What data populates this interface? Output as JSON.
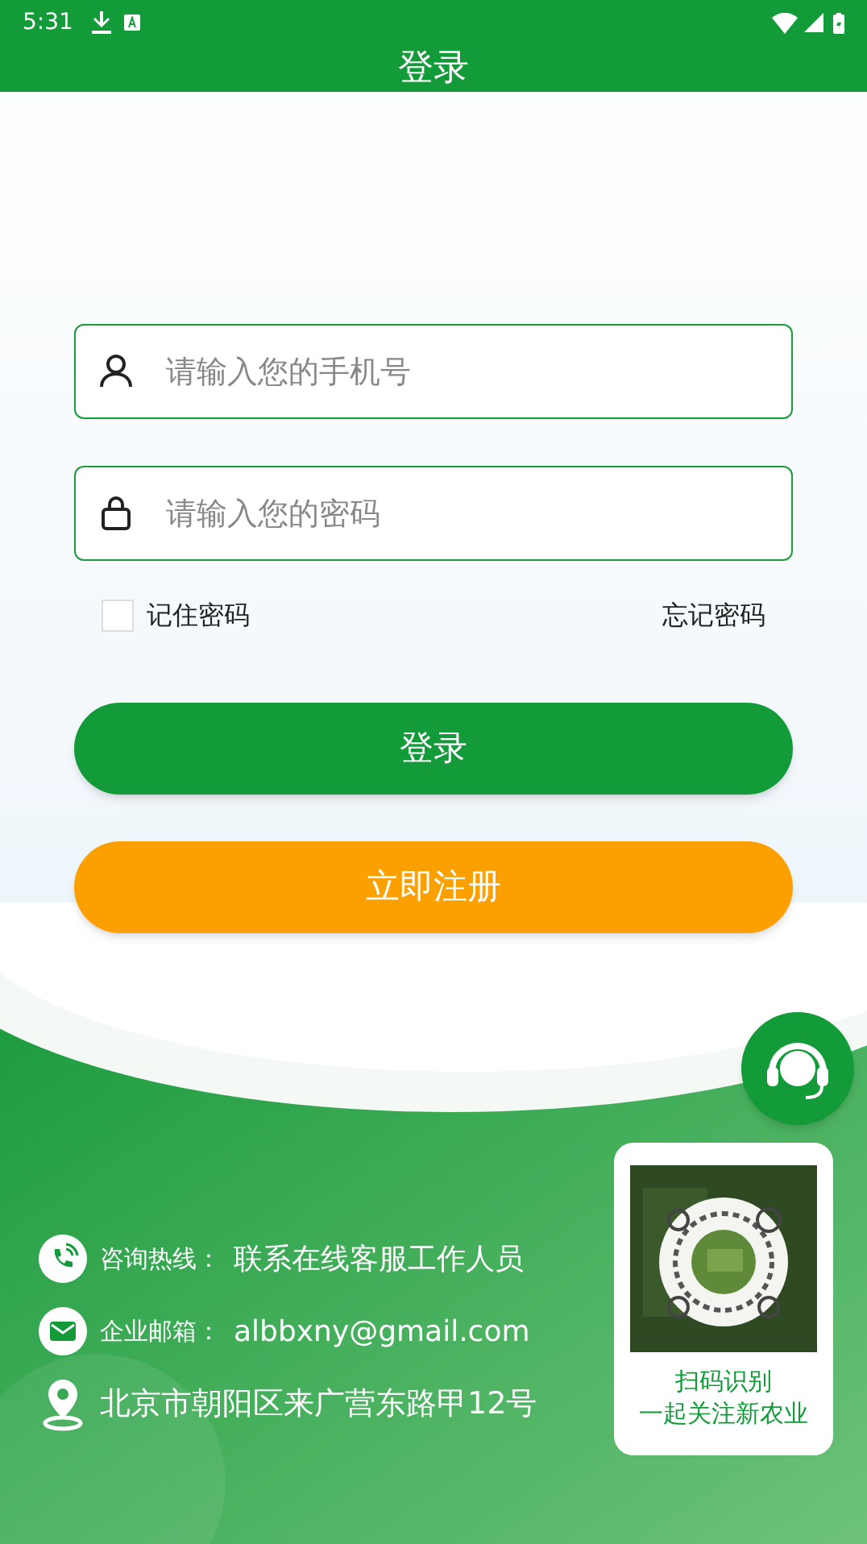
{
  "status_bar": {
    "time": "5:31"
  },
  "header": {
    "title": "登录"
  },
  "fields": [
    {
      "kind": "user",
      "placeholder": "请输入您的手机号"
    },
    {
      "kind": "lock",
      "placeholder": "请输入您的密码"
    }
  ],
  "remember": {
    "label": "记住密码",
    "checked": false
  },
  "forgot_link": "忘记密码",
  "buttons": [
    {
      "kind": "primary",
      "label": "登录"
    },
    {
      "kind": "secondary",
      "label": "立即注册"
    }
  ],
  "contacts": [
    {
      "kind": "phone",
      "label": "咨询热线：",
      "value": "联系在线客服工作人员"
    },
    {
      "kind": "mail",
      "label": "企业邮箱：",
      "value": "albbxny@gmail.com"
    },
    {
      "kind": "location",
      "value": "北京市朝阳区来广营东路甲12号"
    }
  ],
  "qr_card": {
    "picture": {
      "kind": "picture"
    },
    "caption": [
      "扫码识别",
      "一起关注新农业"
    ]
  }
}
